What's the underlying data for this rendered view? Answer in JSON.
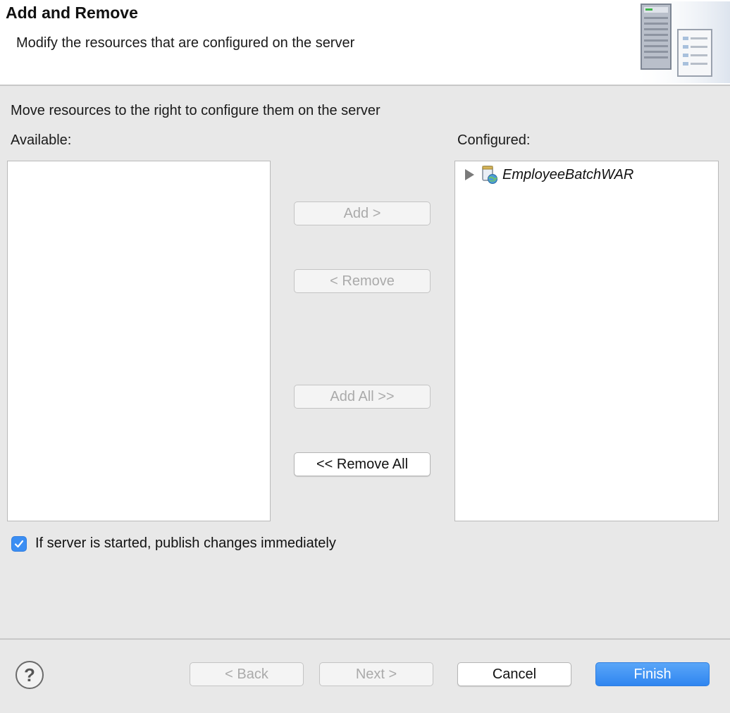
{
  "header": {
    "title": "Add and Remove",
    "subtitle": "Modify the resources that are configured on the server",
    "graphic_icon": "server-wizard-icon"
  },
  "instruction": "Move resources to the right to configure them on the server",
  "available": {
    "label": "Available:",
    "items": []
  },
  "configured": {
    "label": "Configured:",
    "items": [
      {
        "label": "EmployeeBatchWAR",
        "icon": "web-module-icon",
        "expanded": false
      }
    ]
  },
  "buttons": {
    "add": "Add >",
    "remove": "< Remove",
    "add_all": "Add All >>",
    "remove_all": "<< Remove All"
  },
  "publish_option": {
    "label": "If server is started, publish changes immediately",
    "checked": true
  },
  "footer": {
    "help_icon": "help-icon",
    "back": "< Back",
    "next": "Next >",
    "cancel": "Cancel",
    "finish": "Finish"
  },
  "colors": {
    "accent": "#3b8ef3",
    "dialog_background": "#e8e8e8",
    "disabled_text": "#aaaaaa"
  }
}
